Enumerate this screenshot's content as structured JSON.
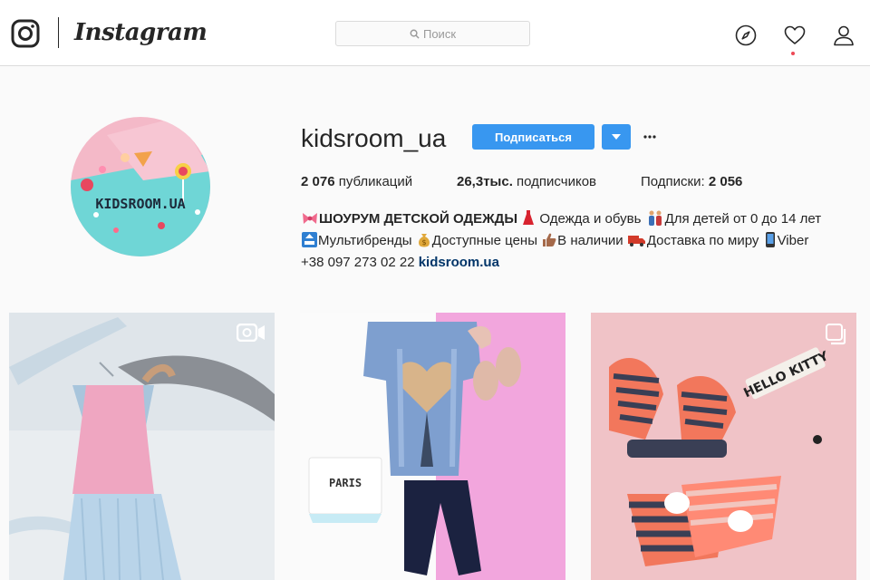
{
  "nav": {
    "wordmark": "Instagram",
    "search_placeholder": "Поиск",
    "icons": [
      "instagram-glyph-icon",
      "search-icon",
      "explore-compass-icon",
      "activity-heart-icon",
      "profile-person-icon"
    ],
    "activity_dot_color": "#ed4956"
  },
  "profile": {
    "username": "kidsroom_ua",
    "follow_label": "Подписаться",
    "avatar_text": "KIDSROOM.UA",
    "stats": {
      "posts_value": "2 076",
      "posts_label": "публикаций",
      "followers_value": "26,3тыс.",
      "followers_label": "подписчиков",
      "following_label": "Подписки:",
      "following_value": "2 056"
    },
    "bio": {
      "title": "ШОУРУМ ДЕТСКОЙ ОДЕЖДЫ",
      "line1_a": " Одежда и обувь ",
      "line1_b": "Для детей от 0 до 14 лет",
      "line2_a": "Мультибренды ",
      "line2_b": "Доступные цены ",
      "line2_c": "В наличии ",
      "line2_d": "Доставка по миру ",
      "line2_e": "Viber",
      "phone": "+38 097 273 02 22 ",
      "link": "kidsroom.ua"
    },
    "accent_color": "#3897f0"
  },
  "posts": [
    {
      "badge": "video-camera-icon"
    },
    {
      "badge": "",
      "sign_text": "PARIS"
    },
    {
      "badge": "carousel-icon",
      "sign_text": "HELLO KITTY"
    }
  ]
}
